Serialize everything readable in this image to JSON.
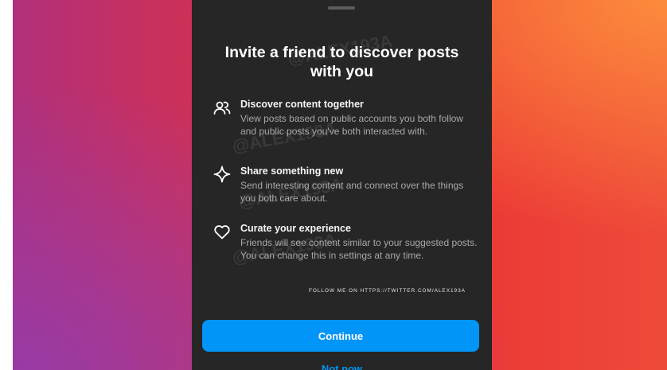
{
  "modal": {
    "title_line1": "Invite a friend to discover posts",
    "title_line2": "with you",
    "features": [
      {
        "icon": "people-icon",
        "heading": "Discover content together",
        "description": "View posts based on public accounts you both follow and public posts you've both interacted with."
      },
      {
        "icon": "sparkle-icon",
        "heading": "Share something new",
        "description": "Send interesting content and connect over the things you both care about."
      },
      {
        "icon": "heart-icon",
        "heading": "Curate your experience",
        "description": "Friends will see content similar to your suggested posts. You can change this in settings at any time."
      }
    ],
    "continue_label": "Continue",
    "not_now_label": "Not now"
  },
  "watermark": {
    "handle": "@ALEX193A",
    "follow_text": "FOLLOW ME ON HTTPS://TWITTER.COM/ALEX193A"
  },
  "colors": {
    "sheet_background": "#262626",
    "primary_button": "#0095f6",
    "link": "#0095f6"
  }
}
